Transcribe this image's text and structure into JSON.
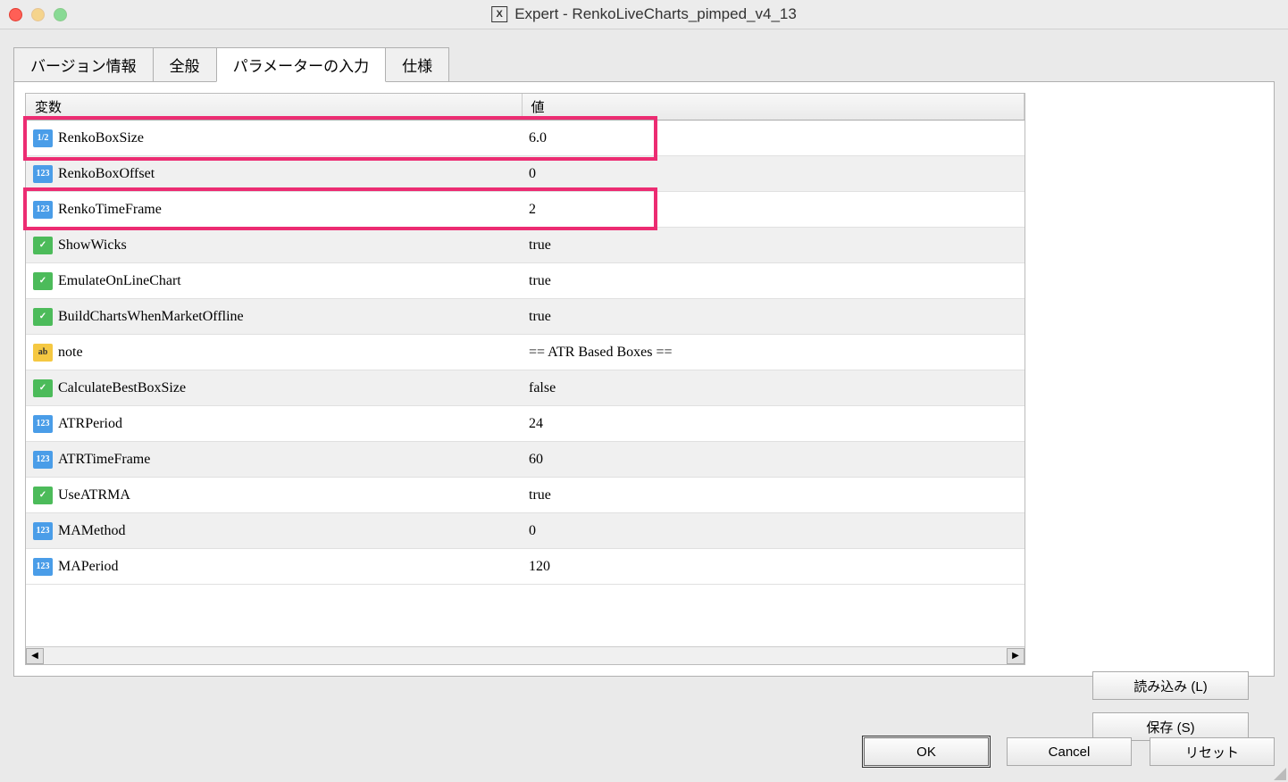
{
  "window": {
    "title": "Expert - RenkoLiveCharts_pimped_v4_13",
    "icon_label": "X"
  },
  "tabs": {
    "version": "バージョン情報",
    "general": "全般",
    "inputs": "パラメーターの入力",
    "spec": "仕様"
  },
  "headers": {
    "variable": "変数",
    "value": "値"
  },
  "params": [
    {
      "icon": "double",
      "icon_text": "1/2",
      "name": "RenkoBoxSize",
      "value": "6.0"
    },
    {
      "icon": "int",
      "icon_text": "123",
      "name": "RenkoBoxOffset",
      "value": "0"
    },
    {
      "icon": "int",
      "icon_text": "123",
      "name": "RenkoTimeFrame",
      "value": "2"
    },
    {
      "icon": "bool",
      "icon_text": "✓",
      "name": "ShowWicks",
      "value": "true"
    },
    {
      "icon": "bool",
      "icon_text": "✓",
      "name": "EmulateOnLineChart",
      "value": "true"
    },
    {
      "icon": "bool",
      "icon_text": "✓",
      "name": "BuildChartsWhenMarketOffline",
      "value": "true"
    },
    {
      "icon": "string",
      "icon_text": "ab",
      "name": "note",
      "value": "== ATR Based Boxes =="
    },
    {
      "icon": "bool",
      "icon_text": "✓",
      "name": "CalculateBestBoxSize",
      "value": "false"
    },
    {
      "icon": "int",
      "icon_text": "123",
      "name": "ATRPeriod",
      "value": "24"
    },
    {
      "icon": "int",
      "icon_text": "123",
      "name": "ATRTimeFrame",
      "value": "60"
    },
    {
      "icon": "bool",
      "icon_text": "✓",
      "name": "UseATRMA",
      "value": "true"
    },
    {
      "icon": "int",
      "icon_text": "123",
      "name": "MAMethod",
      "value": "0"
    },
    {
      "icon": "int",
      "icon_text": "123",
      "name": "MAPeriod",
      "value": "120"
    }
  ],
  "buttons": {
    "load": "読み込み (L)",
    "save": "保存 (S)",
    "ok": "OK",
    "cancel": "Cancel",
    "reset": "リセット"
  }
}
